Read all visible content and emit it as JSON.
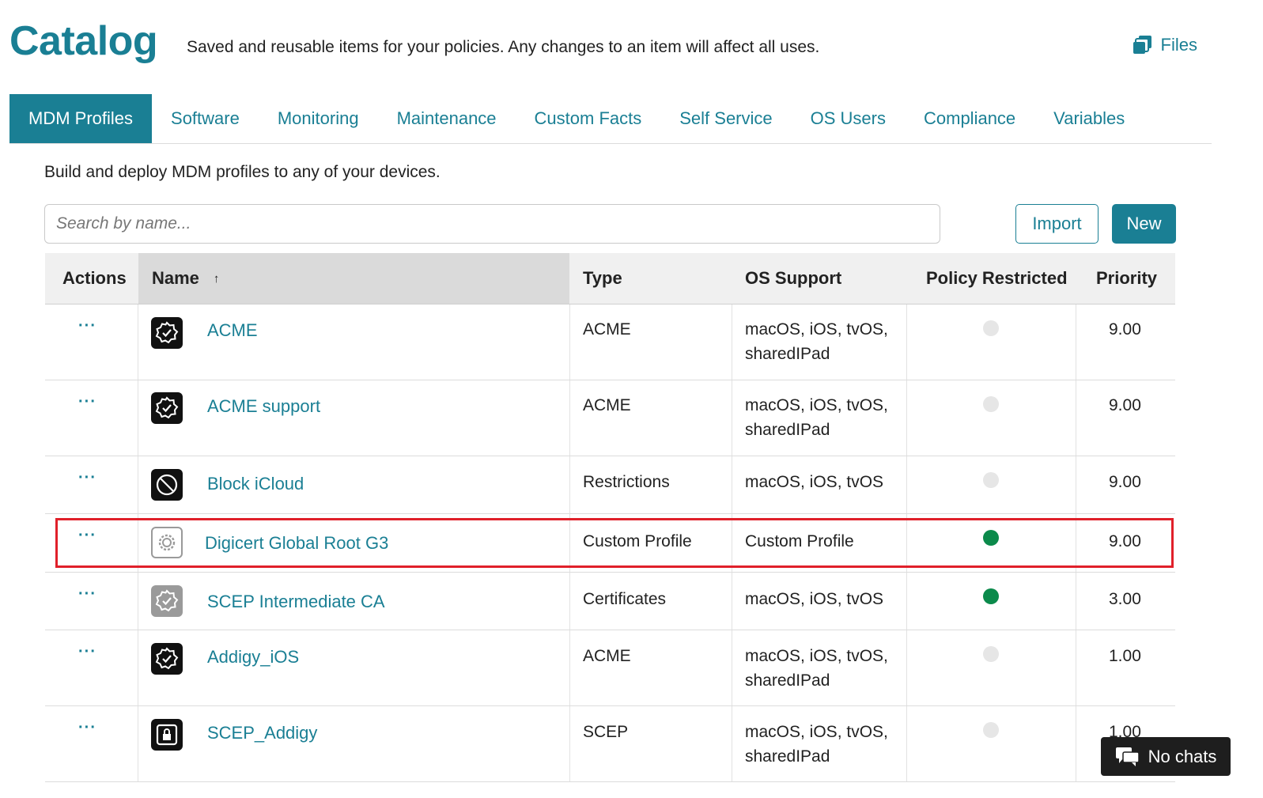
{
  "header": {
    "title": "Catalog",
    "subtitle": "Saved and reusable items for your policies. Any changes to an item will affect all uses.",
    "files_label": "Files"
  },
  "tabs": [
    {
      "label": "MDM Profiles",
      "active": true
    },
    {
      "label": "Software"
    },
    {
      "label": "Monitoring"
    },
    {
      "label": "Maintenance"
    },
    {
      "label": "Custom Facts"
    },
    {
      "label": "Self Service"
    },
    {
      "label": "OS Users"
    },
    {
      "label": "Compliance"
    },
    {
      "label": "Variables"
    }
  ],
  "main": {
    "description": "Build and deploy MDM profiles to any of your devices.",
    "search_placeholder": "Search by name...",
    "import_label": "Import",
    "new_label": "New"
  },
  "table": {
    "headers": {
      "actions": "Actions",
      "name": "Name",
      "sort_indicator": "↑",
      "type": "Type",
      "os_support": "OS Support",
      "policy_restricted": "Policy Restricted",
      "priority": "Priority"
    },
    "actions_glyph": "···",
    "rows": [
      {
        "name": "ACME",
        "icon": "badge-check-icon",
        "type": "ACME",
        "os": "macOS, iOS, tvOS, sharedIPad",
        "restricted": false,
        "priority": "9.00"
      },
      {
        "name": "ACME support",
        "icon": "badge-check-icon",
        "type": "ACME",
        "os": "macOS, iOS, tvOS, sharedIPad",
        "restricted": false,
        "priority": "9.00"
      },
      {
        "name": "Block iCloud",
        "icon": "restriction-icon",
        "type": "Restrictions",
        "os": "macOS, iOS, tvOS",
        "restricted": false,
        "priority": "9.00"
      },
      {
        "name": "Digicert Global Root G3",
        "icon": "gear-icon",
        "type": "Custom Profile",
        "os": "Custom Profile",
        "restricted": true,
        "priority": "9.00",
        "highlighted": true
      },
      {
        "name": "SCEP Intermediate CA",
        "icon": "certificate-icon",
        "type": "Certificates",
        "os": "macOS, iOS, tvOS",
        "restricted": true,
        "priority": "3.00"
      },
      {
        "name": "Addigy_iOS",
        "icon": "badge-check-icon",
        "type": "ACME",
        "os": "macOS, iOS, tvOS, sharedIPad",
        "restricted": false,
        "priority": "1.00"
      },
      {
        "name": "SCEP_Addigy",
        "icon": "lock-icon",
        "type": "SCEP",
        "os": "macOS, iOS, tvOS, sharedIPad",
        "restricted": false,
        "priority": "1.00"
      }
    ]
  },
  "chat": {
    "label": "No chats"
  },
  "colors": {
    "accent": "#1a7f94",
    "restricted_on": "#0b8a4b",
    "restricted_off": "#e6e6e6",
    "highlight": "#e0202a"
  }
}
